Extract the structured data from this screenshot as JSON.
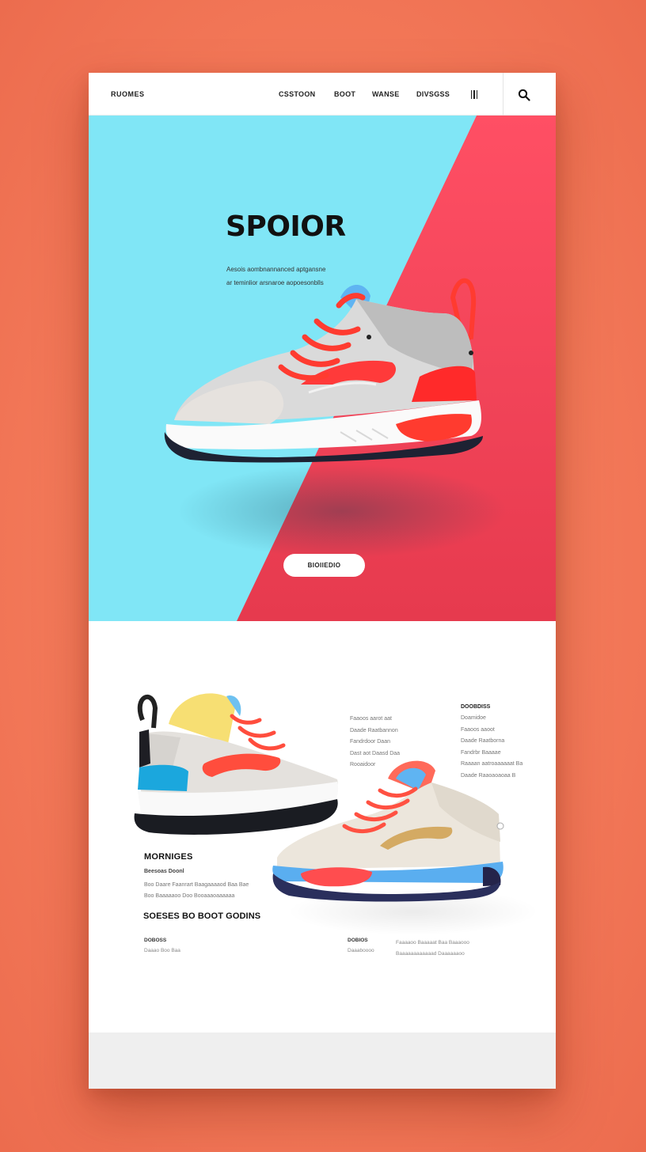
{
  "colors": {
    "page_background": "#f47a5a",
    "hero_cyan": "#80e6f6",
    "hero_red": "#f0465a",
    "accent_red": "#ff4a3d",
    "text_dark": "#111111"
  },
  "nav": {
    "brand": "RUOMES",
    "links": [
      "CSSTOON",
      "BOOT",
      "WANSE",
      "DIVSGSS"
    ],
    "menu_icon": "menu-bars-icon",
    "search_icon": "search-icon"
  },
  "hero": {
    "title": "SPOIOR",
    "subtitle_lines": [
      "Aesois aombnannanced aptgansne",
      "ar teminlior arsnaroe aopoesonblls"
    ],
    "cta_label": "BIOIIEDIO"
  },
  "details": {
    "middle_lines": [
      "Faaoos aarot aat",
      "Daade Raatbannon",
      "Fandrdoor Daan",
      "Dast aot Daasd Daa",
      "Rooaidoor"
    ],
    "right_heading": "DOOBDISS",
    "right_lines": [
      "Doamidoe",
      "Faaoos aaoot",
      "Daade Raatborna",
      "Fandrbr Baaaae",
      "Raaaan aatroaaaaaat Ba",
      "Daade Raaoaoaoaa B"
    ]
  },
  "feature": {
    "title": "MORNIGES",
    "tag": "Beesoas Doonl",
    "lines": [
      "Boo Daare Faanrart Baagaaaaod Baa Bae",
      "Boo Baaaaaoo Doo Booaaaoaaaaaa"
    ]
  },
  "section_heading": "SOESES BO BOOT GODINS",
  "footer_columns": [
    {
      "heading": "DOBOSS",
      "items": [
        "Daaao Boo Baa"
      ]
    },
    {
      "heading": "DOBIOS",
      "items": [
        "Daaaboooo"
      ]
    },
    {
      "heading": "",
      "items": [
        "Faaaaoo Baaaaat Baa Baaaooo",
        "Baaaaaaaaaaaad Daaaaaaoo"
      ]
    }
  ]
}
